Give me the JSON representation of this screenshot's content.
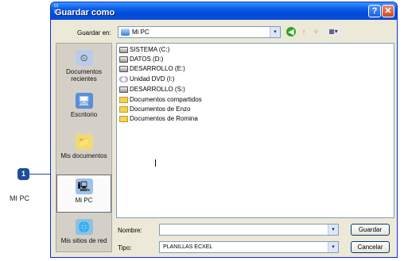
{
  "callout": {
    "number": "1",
    "label": "MI PC"
  },
  "titlebar": {
    "title": "Guardar como",
    "icon_text": "01 02",
    "help": "?",
    "close": "✕"
  },
  "lookin": {
    "label": "Guardar en:",
    "value": "Mi PC",
    "dropdown": "▾"
  },
  "toolbar": {
    "back": "◀",
    "up": "↑",
    "new_folder": "✧",
    "views": "▦▾"
  },
  "places": [
    {
      "label": "Documentos recientes",
      "icon": "recent-docs-icon",
      "glyph": "⏲"
    },
    {
      "label": "Escritorio",
      "icon": "desktop-icon",
      "glyph": "🖥"
    },
    {
      "label": "Mis documentos",
      "icon": "my-documents-icon",
      "glyph": "📁"
    },
    {
      "label": "Mi PC",
      "icon": "my-computer-icon",
      "glyph": "🖳"
    },
    {
      "label": "Mis sitios de red",
      "icon": "network-icon",
      "glyph": "🌐"
    }
  ],
  "files": [
    {
      "name": "SISTEMA (C:)",
      "type": "drive"
    },
    {
      "name": "DATOS (D:)",
      "type": "drive"
    },
    {
      "name": "DESARROLLO (E:)",
      "type": "drive"
    },
    {
      "name": "Unidad DVD (I:)",
      "type": "dvd"
    },
    {
      "name": "DESARROLLO (S:)",
      "type": "drive"
    },
    {
      "name": "Documentos compartidos",
      "type": "folder"
    },
    {
      "name": "Documentos de Enzo",
      "type": "folder"
    },
    {
      "name": "Documentos de Romina",
      "type": "folder"
    }
  ],
  "filename": {
    "label": "Nombre:",
    "value": ""
  },
  "filetype": {
    "label": "Tipo:",
    "value": "PLANILLAS ECXEL"
  },
  "buttons": {
    "save": "Guardar",
    "cancel": "Cancelar"
  }
}
